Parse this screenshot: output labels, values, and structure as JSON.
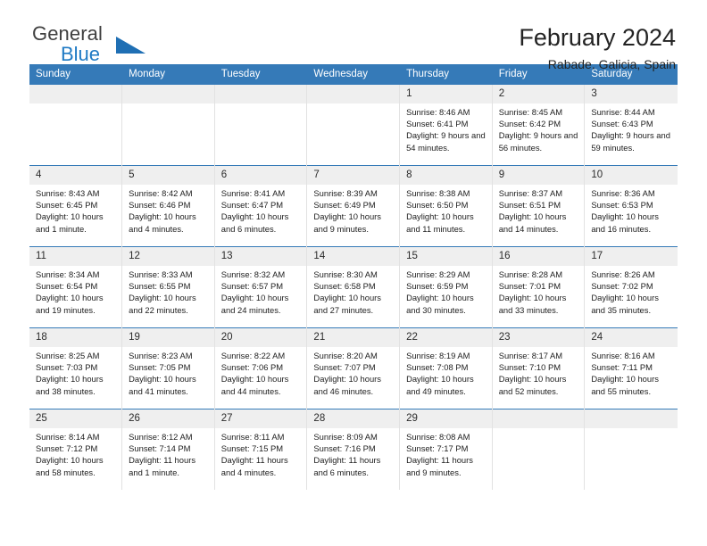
{
  "brand": {
    "name_part1": "General",
    "name_part2": "Blue",
    "accent_color": "#1f7ac4"
  },
  "header": {
    "title": "February 2024",
    "subtitle": "Rabade, Galicia, Spain"
  },
  "calendar": {
    "header_color": "#357ab8",
    "weekday_headers": [
      "Sunday",
      "Monday",
      "Tuesday",
      "Wednesday",
      "Thursday",
      "Friday",
      "Saturday"
    ],
    "weeks": [
      [
        {
          "day": "",
          "sunrise": "",
          "sunset": "",
          "daylight": ""
        },
        {
          "day": "",
          "sunrise": "",
          "sunset": "",
          "daylight": ""
        },
        {
          "day": "",
          "sunrise": "",
          "sunset": "",
          "daylight": ""
        },
        {
          "day": "",
          "sunrise": "",
          "sunset": "",
          "daylight": ""
        },
        {
          "day": "1",
          "sunrise": "Sunrise: 8:46 AM",
          "sunset": "Sunset: 6:41 PM",
          "daylight": "Daylight: 9 hours and 54 minutes."
        },
        {
          "day": "2",
          "sunrise": "Sunrise: 8:45 AM",
          "sunset": "Sunset: 6:42 PM",
          "daylight": "Daylight: 9 hours and 56 minutes."
        },
        {
          "day": "3",
          "sunrise": "Sunrise: 8:44 AM",
          "sunset": "Sunset: 6:43 PM",
          "daylight": "Daylight: 9 hours and 59 minutes."
        }
      ],
      [
        {
          "day": "4",
          "sunrise": "Sunrise: 8:43 AM",
          "sunset": "Sunset: 6:45 PM",
          "daylight": "Daylight: 10 hours and 1 minute."
        },
        {
          "day": "5",
          "sunrise": "Sunrise: 8:42 AM",
          "sunset": "Sunset: 6:46 PM",
          "daylight": "Daylight: 10 hours and 4 minutes."
        },
        {
          "day": "6",
          "sunrise": "Sunrise: 8:41 AM",
          "sunset": "Sunset: 6:47 PM",
          "daylight": "Daylight: 10 hours and 6 minutes."
        },
        {
          "day": "7",
          "sunrise": "Sunrise: 8:39 AM",
          "sunset": "Sunset: 6:49 PM",
          "daylight": "Daylight: 10 hours and 9 minutes."
        },
        {
          "day": "8",
          "sunrise": "Sunrise: 8:38 AM",
          "sunset": "Sunset: 6:50 PM",
          "daylight": "Daylight: 10 hours and 11 minutes."
        },
        {
          "day": "9",
          "sunrise": "Sunrise: 8:37 AM",
          "sunset": "Sunset: 6:51 PM",
          "daylight": "Daylight: 10 hours and 14 minutes."
        },
        {
          "day": "10",
          "sunrise": "Sunrise: 8:36 AM",
          "sunset": "Sunset: 6:53 PM",
          "daylight": "Daylight: 10 hours and 16 minutes."
        }
      ],
      [
        {
          "day": "11",
          "sunrise": "Sunrise: 8:34 AM",
          "sunset": "Sunset: 6:54 PM",
          "daylight": "Daylight: 10 hours and 19 minutes."
        },
        {
          "day": "12",
          "sunrise": "Sunrise: 8:33 AM",
          "sunset": "Sunset: 6:55 PM",
          "daylight": "Daylight: 10 hours and 22 minutes."
        },
        {
          "day": "13",
          "sunrise": "Sunrise: 8:32 AM",
          "sunset": "Sunset: 6:57 PM",
          "daylight": "Daylight: 10 hours and 24 minutes."
        },
        {
          "day": "14",
          "sunrise": "Sunrise: 8:30 AM",
          "sunset": "Sunset: 6:58 PM",
          "daylight": "Daylight: 10 hours and 27 minutes."
        },
        {
          "day": "15",
          "sunrise": "Sunrise: 8:29 AM",
          "sunset": "Sunset: 6:59 PM",
          "daylight": "Daylight: 10 hours and 30 minutes."
        },
        {
          "day": "16",
          "sunrise": "Sunrise: 8:28 AM",
          "sunset": "Sunset: 7:01 PM",
          "daylight": "Daylight: 10 hours and 33 minutes."
        },
        {
          "day": "17",
          "sunrise": "Sunrise: 8:26 AM",
          "sunset": "Sunset: 7:02 PM",
          "daylight": "Daylight: 10 hours and 35 minutes."
        }
      ],
      [
        {
          "day": "18",
          "sunrise": "Sunrise: 8:25 AM",
          "sunset": "Sunset: 7:03 PM",
          "daylight": "Daylight: 10 hours and 38 minutes."
        },
        {
          "day": "19",
          "sunrise": "Sunrise: 8:23 AM",
          "sunset": "Sunset: 7:05 PM",
          "daylight": "Daylight: 10 hours and 41 minutes."
        },
        {
          "day": "20",
          "sunrise": "Sunrise: 8:22 AM",
          "sunset": "Sunset: 7:06 PM",
          "daylight": "Daylight: 10 hours and 44 minutes."
        },
        {
          "day": "21",
          "sunrise": "Sunrise: 8:20 AM",
          "sunset": "Sunset: 7:07 PM",
          "daylight": "Daylight: 10 hours and 46 minutes."
        },
        {
          "day": "22",
          "sunrise": "Sunrise: 8:19 AM",
          "sunset": "Sunset: 7:08 PM",
          "daylight": "Daylight: 10 hours and 49 minutes."
        },
        {
          "day": "23",
          "sunrise": "Sunrise: 8:17 AM",
          "sunset": "Sunset: 7:10 PM",
          "daylight": "Daylight: 10 hours and 52 minutes."
        },
        {
          "day": "24",
          "sunrise": "Sunrise: 8:16 AM",
          "sunset": "Sunset: 7:11 PM",
          "daylight": "Daylight: 10 hours and 55 minutes."
        }
      ],
      [
        {
          "day": "25",
          "sunrise": "Sunrise: 8:14 AM",
          "sunset": "Sunset: 7:12 PM",
          "daylight": "Daylight: 10 hours and 58 minutes."
        },
        {
          "day": "26",
          "sunrise": "Sunrise: 8:12 AM",
          "sunset": "Sunset: 7:14 PM",
          "daylight": "Daylight: 11 hours and 1 minute."
        },
        {
          "day": "27",
          "sunrise": "Sunrise: 8:11 AM",
          "sunset": "Sunset: 7:15 PM",
          "daylight": "Daylight: 11 hours and 4 minutes."
        },
        {
          "day": "28",
          "sunrise": "Sunrise: 8:09 AM",
          "sunset": "Sunset: 7:16 PM",
          "daylight": "Daylight: 11 hours and 6 minutes."
        },
        {
          "day": "29",
          "sunrise": "Sunrise: 8:08 AM",
          "sunset": "Sunset: 7:17 PM",
          "daylight": "Daylight: 11 hours and 9 minutes."
        },
        {
          "day": "",
          "sunrise": "",
          "sunset": "",
          "daylight": ""
        },
        {
          "day": "",
          "sunrise": "",
          "sunset": "",
          "daylight": ""
        }
      ]
    ]
  }
}
